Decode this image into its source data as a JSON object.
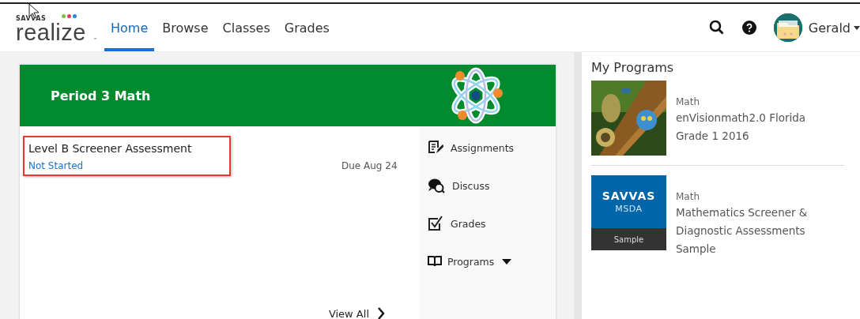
{
  "header": {
    "logo": {
      "brand": "SAVVAS",
      "product": "realize",
      "mark": "™"
    },
    "nav": [
      {
        "label": "Home",
        "selected": true
      },
      {
        "label": "Browse",
        "selected": false
      },
      {
        "label": "Classes",
        "selected": false
      },
      {
        "label": "Grades",
        "selected": false
      }
    ],
    "user": {
      "name": "Gerald"
    }
  },
  "class_card": {
    "title": "Period 3 Math",
    "assignment": {
      "title": "Level B Screener Assessment",
      "status": "Not Started",
      "due": "Due Aug 24",
      "highlighted": true
    },
    "view_all": "View All",
    "menu": [
      {
        "label": "Assignments",
        "kind": "link"
      },
      {
        "label": "Discuss",
        "kind": "link"
      },
      {
        "label": "Grades",
        "kind": "link"
      },
      {
        "label": "Programs",
        "kind": "dropdown"
      }
    ]
  },
  "my_programs": {
    "title": "My Programs",
    "programs": [
      {
        "subject": "Math",
        "name": "enVisionmath2.0 Florida Grade 1 2016"
      },
      {
        "subject": "Math",
        "name": "Mathematics Screener & Diagnostic Assessments Sample",
        "cover": {
          "kind": "logo",
          "brand": "SAVVAS",
          "title": "MSDA",
          "label": "Sample"
        }
      }
    ]
  }
}
